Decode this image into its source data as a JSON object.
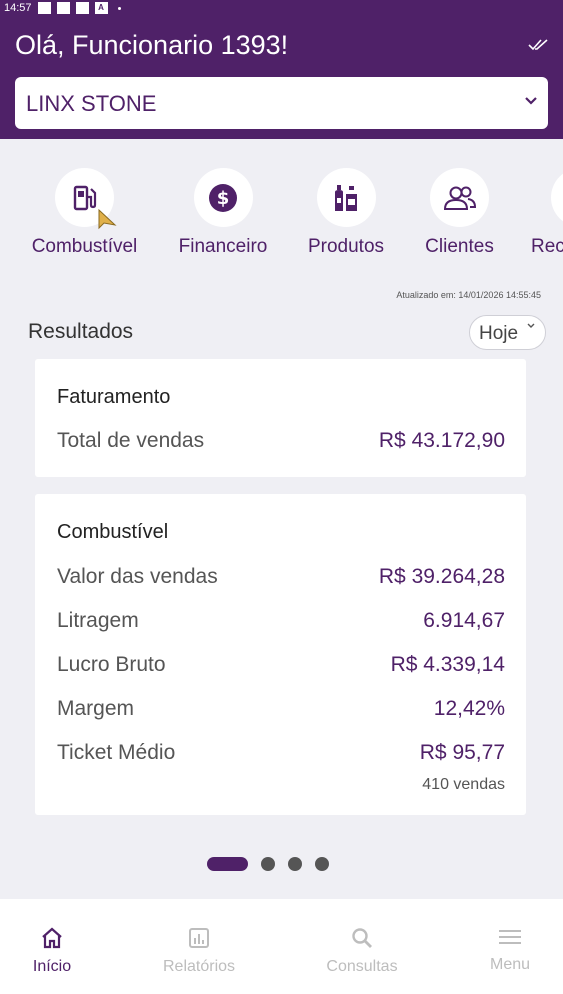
{
  "status_bar": {
    "time": "14:57"
  },
  "header": {
    "greeting": "Olá, Funcionario 1393!",
    "store_select": {
      "value": "LINX STONE"
    }
  },
  "categories": [
    {
      "label": "Combustível",
      "icon": "fuel-pump-icon"
    },
    {
      "label": "Financeiro",
      "icon": "dollar-icon"
    },
    {
      "label": "Produtos",
      "icon": "bottles-icon"
    },
    {
      "label": "Clientes",
      "icon": "users-icon"
    },
    {
      "label": "Rec",
      "icon": "partial-icon"
    }
  ],
  "updated_at": "Atualizado em: 14/01/2026 14:55:45",
  "results": {
    "title": "Resultados",
    "period": "Hoje"
  },
  "faturamento": {
    "title": "Faturamento",
    "rows": [
      {
        "label": "Total de vendas",
        "value": "R$ 43.172,90"
      }
    ]
  },
  "combustivel": {
    "title": "Combustível",
    "rows": [
      {
        "label": "Valor das vendas",
        "value": "R$ 39.264,28"
      },
      {
        "label": "Litragem",
        "value": "6.914,67"
      },
      {
        "label": "Lucro Bruto",
        "value": "R$ 4.339,14"
      },
      {
        "label": "Margem",
        "value": "12,42%"
      },
      {
        "label": "Ticket Médio",
        "value": "R$ 95,77"
      }
    ],
    "note": "410 vendas"
  },
  "carousel": {
    "pages": 4,
    "active": 1
  },
  "bottom_nav": [
    {
      "label": "Início",
      "icon": "home-icon",
      "active": true
    },
    {
      "label": "Relatórios",
      "icon": "chart-icon",
      "active": false
    },
    {
      "label": "Consultas",
      "icon": "search-icon",
      "active": false
    },
    {
      "label": "Menu",
      "icon": "menu-icon",
      "active": false
    }
  ],
  "colors": {
    "primary": "#4f2168",
    "background": "#efeff4",
    "inactive": "#bdbdbd"
  }
}
